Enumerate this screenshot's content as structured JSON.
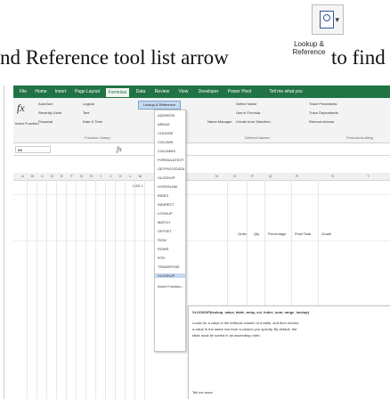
{
  "top_icon": {
    "name": "lookup-reference-icon"
  },
  "caption": {
    "before": "nd Reference tool list arrow",
    "inline_label_line1": "Lookup &",
    "inline_label_line2": "Reference",
    "after": "to find"
  },
  "excel": {
    "tabs": [
      "File",
      "Home",
      "Insert",
      "Page Layout",
      "Formulas",
      "Data",
      "Review",
      "View",
      "Developer",
      "Power Pivot",
      "Tell me what you"
    ],
    "active_tab": "Formulas",
    "ribbon": {
      "insert_function": "Insert Function",
      "autosum": "AutoSum",
      "recently_used": "Recently Used",
      "financial": "Financial",
      "logical": "Logical",
      "text": "Text",
      "date_time": "Date & Time",
      "lookup_reference": "Lookup & Reference",
      "function_library": "Function Library",
      "name_manager": "Name Manager",
      "define_name": "Define Name",
      "use_in_formula": "Use in Formula",
      "create_from_selection": "Create from Selection",
      "defined_names": "Defined Names",
      "trace_precedents": "Trace Precedents",
      "trace_dependents": "Trace Dependents",
      "remove_arrows": "Remove Arrows",
      "formula_auditing": "Formula Auditing"
    },
    "name_box": "B5",
    "fx": "fx",
    "cell_label": "CAS 1",
    "dropdown_items": [
      "ADDRESS",
      "AREAS",
      "CHOOSE",
      "COLUMN",
      "COLUMNS",
      "FORMULATEXT",
      "GETPIVOTDATA",
      "HLOOKUP",
      "HYPERLINK",
      "INDEX",
      "INDIRECT",
      "LOOKUP",
      "MATCH",
      "OFFSET",
      "ROW",
      "ROWS",
      "RTD",
      "TRANSPOSE",
      "VLOOKUP",
      "Insert Function..."
    ],
    "highlight_item": "VLOOKUP",
    "tooltip": {
      "signature": "VLOOKUP(lookup_value, table_array, col_index_num, range_lookup)",
      "lines": [
        "Looks for a value in the leftmost column of a table, and then returns",
        "a value in the same row from a column you specify. By default, the",
        "table must be sorted in an ascending order."
      ],
      "tell_me_more": "Tell me more"
    },
    "col_headers": [
      "A",
      "B",
      "C",
      "D",
      "E",
      "F",
      "G",
      "H",
      "I",
      "J",
      "K",
      "L",
      "M",
      "N",
      "O",
      "P",
      "Q",
      "R",
      "S",
      "T"
    ],
    "right_headers": [
      "Order",
      "Qty",
      "Percentage",
      "Final Total",
      "Grade"
    ]
  },
  "colors": {
    "excel_green": "#217346",
    "highlight_blue": "#c5d9f1"
  }
}
